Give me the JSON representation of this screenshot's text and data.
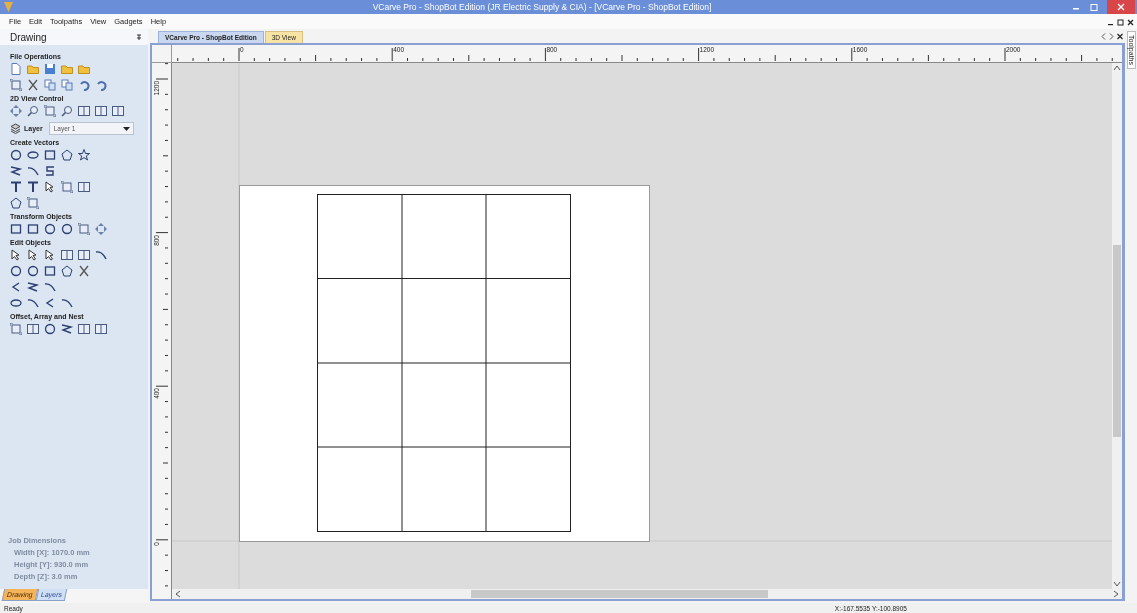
{
  "window": {
    "title": "VCarve Pro - ShopBot Edition (JR Electric Supply & CIA) - [VCarve Pro - ShopBot Edition]"
  },
  "menu": [
    "File",
    "Edit",
    "Toolpaths",
    "View",
    "Gadgets",
    "Help"
  ],
  "panel": {
    "title": "Drawing",
    "groups": [
      {
        "kind": "tools",
        "title": "File Operations"
      },
      {
        "kind": "tools",
        "title": "2D View Control"
      },
      {
        "kind": "layer",
        "label": "Layer",
        "value": "Layer 1"
      },
      {
        "kind": "tools",
        "title": "Create Vectors"
      },
      {
        "kind": "tools",
        "title": "Transform Objects"
      },
      {
        "kind": "tools",
        "title": "Edit Objects"
      },
      {
        "kind": "tools",
        "title": "Offset, Array and Nest"
      }
    ],
    "job_dimensions": {
      "title": "Job Dimensions",
      "disabled": true,
      "lines": [
        "Width [X]: 1070.0 mm",
        "Height [Y]: 930.0 mm",
        "Depth [Z]: 3.0 mm"
      ]
    },
    "tabs": [
      {
        "label": "Drawing",
        "selected": true
      },
      {
        "label": "Layers",
        "selected": false
      }
    ]
  },
  "document_tabs": [
    {
      "label": "VCarve Pro - ShopBot Edition",
      "selected": true
    },
    {
      "label": "3D View",
      "selected": false
    }
  ],
  "rulers": {
    "horizontal": [
      "0",
      "400",
      "800",
      "1200",
      "1600",
      "2000"
    ],
    "vertical": [
      "1200",
      "800",
      "400",
      "0"
    ]
  },
  "side_tab": "Toolpaths",
  "status_bar": {
    "message": "Ready",
    "coordinates": "X:-167.5535 Y:-100.8905"
  }
}
